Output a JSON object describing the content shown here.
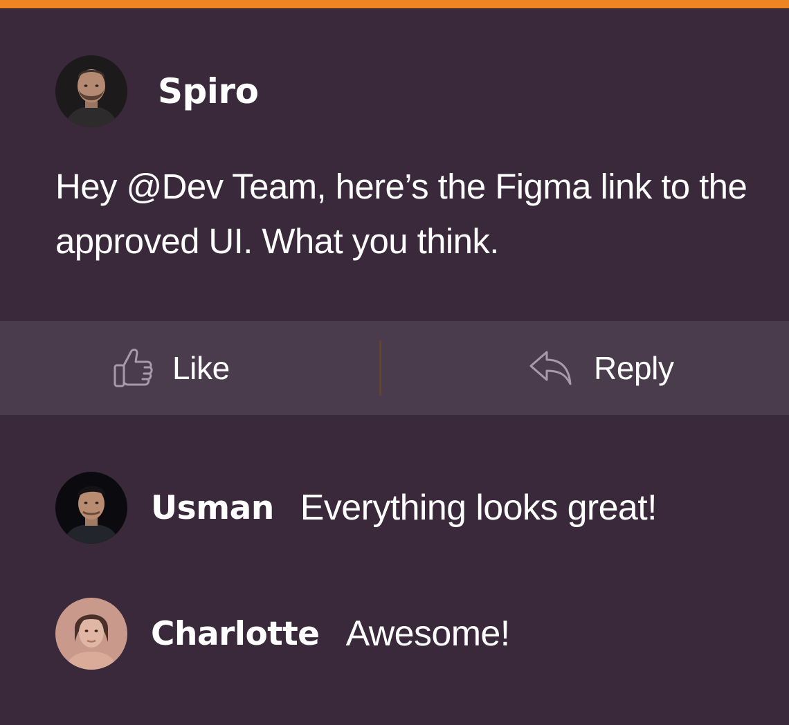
{
  "colors": {
    "background": "#3a283b",
    "accent_bar": "#ef8423",
    "action_bar": "#4b3c4d",
    "text": "#ffffff",
    "icon": "#a99aab"
  },
  "post": {
    "author": "Spiro",
    "avatar_icon": "avatar-photo",
    "message": "Hey @Dev Team, here’s the Figma link to the approved UI. What you think."
  },
  "actions": {
    "like_label": "Like",
    "like_icon": "thumbs-up-icon",
    "reply_label": "Reply",
    "reply_icon": "reply-arrow-icon"
  },
  "comments": [
    {
      "author": "Usman",
      "text": "Everything looks great!",
      "avatar_icon": "avatar-photo"
    },
    {
      "author": "Charlotte",
      "text": "Awesome!",
      "avatar_icon": "avatar-photo"
    }
  ]
}
